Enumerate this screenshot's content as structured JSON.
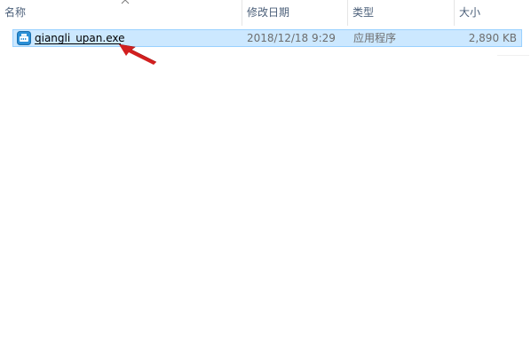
{
  "columns": {
    "name": "名称",
    "modified": "修改日期",
    "type": "类型",
    "size": "大小"
  },
  "sort": {
    "column": "name",
    "direction": "ascending",
    "icon": "chevron-up-icon"
  },
  "files": [
    {
      "name": "qiangli_upan.exe",
      "modified": "2018/12/18 9:29",
      "type": "应用程序",
      "size": "2,890 KB",
      "icon": "application-icon",
      "selected": true
    }
  ],
  "annotation": {
    "icon": "red-arrow-icon",
    "color": "#d21f1f"
  },
  "colors": {
    "selection_bg": "#cce8ff",
    "selection_border": "#99d1ff",
    "header_text": "#4c607a"
  }
}
